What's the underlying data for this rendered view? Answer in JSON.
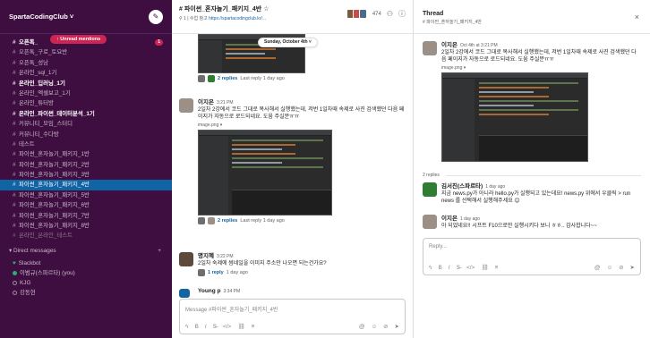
{
  "sidebar": {
    "workspace": "SpartaCodingClub ˅",
    "unread_pill": "↑ Unread mentions",
    "channels": [
      {
        "label": "오픈톡_",
        "style": "bold",
        "mention": "1"
      },
      {
        "label": "오픈톡_구로_토요반",
        "style": "normal"
      },
      {
        "label": "오픈톡_성남",
        "style": "normal"
      },
      {
        "label": "온라인_sql_1기",
        "style": "normal"
      },
      {
        "label": "온라인_딥러닝_1기",
        "style": "bold"
      },
      {
        "label": "온라인_엑셀보고_1기",
        "style": "normal"
      },
      {
        "label": "온라인_튜터방",
        "style": "normal"
      },
      {
        "label": "온라인_파이썬_데이터분석_1기",
        "style": "bold"
      },
      {
        "label": "커뮤니티_모임_스터디",
        "style": "normal"
      },
      {
        "label": "커뮤니티_수다방",
        "style": "normal"
      },
      {
        "label": "테스트",
        "style": "normal"
      },
      {
        "label": "파이썬_혼자놀기_패키지_1반",
        "style": "normal"
      },
      {
        "label": "파이썬_혼자놀기_패키지_2반",
        "style": "normal"
      },
      {
        "label": "파이썬_혼자놀기_패키지_3반",
        "style": "normal"
      },
      {
        "label": "파이썬_혼자놀기_패키지_4반",
        "style": "active"
      },
      {
        "label": "파이썬_혼자놀기_패키지_5반",
        "style": "normal"
      },
      {
        "label": "파이썬_혼자놀기_패키지_6반",
        "style": "normal"
      },
      {
        "label": "파이썬_혼자놀기_패키지_7반",
        "style": "normal"
      },
      {
        "label": "파이썬_혼자놀기_패키지_8반",
        "style": "normal"
      },
      {
        "label": "온라인_온라인_테스트",
        "style": "dim"
      }
    ],
    "dm_header": "▾ Direct messages",
    "dm_add": "+",
    "dms": [
      {
        "label": "Slackbot",
        "presence": "heart"
      },
      {
        "label": "이범규(스파르타) (you)",
        "presence": "on"
      },
      {
        "label": "KJG",
        "presence": "off"
      },
      {
        "label": "강동현",
        "presence": "off"
      }
    ]
  },
  "main": {
    "title": "# 파이썬_혼자놀기_패키지_4반 ☆",
    "subtitle_prefix": "⚲ 1 | 수업 참고 ",
    "subtitle_link": "https://spartacodingclub.kr/...",
    "member_count": "474",
    "date_pill": "Sunday, October 4th ˅",
    "messages": [
      {
        "replies": "2 replies",
        "last_reply": "Last reply 1 day ago"
      },
      {
        "name": "이지은",
        "time": "3:21 PM",
        "text": "2일차 2강에서 코드 그대로 복사해서 실행했는데, 저번 1일차때 속제로 사진 검색했던 다음 페이지가 자동으로 로드되네요. 도움 주실분ㅠㅠ",
        "image_label": "image.png ▾",
        "replies": "2 replies",
        "last_reply": "Last reply 1 day ago"
      },
      {
        "name": "명지혜",
        "time": "3:22 PM",
        "text": "2일차 숙제에 썸네일을 이미지 주소만 나오면 되는건가요?",
        "replies": "1 reply",
        "last_reply": "1 day ago"
      },
      {
        "name": "Young p",
        "time": "3:34 PM"
      }
    ],
    "composer_placeholder": "Message #파이썬_혼자놀기_패키지_4반"
  },
  "thread": {
    "title": "Thread",
    "subtitle": "# 파이썬_혼자놀기_패키지_4반",
    "close": "×",
    "parent": {
      "name": "이지은",
      "time": "Oct 4th at 3:21 PM",
      "text": "2일차 2강에서 코드 그대로 복사해서 실행했는데, 저번 1일차때 속제로 사진 검색했던 다음 페이지가 자동으로 로드되네요. 도움 주실분ㅠㅠ",
      "image_label": "image.png ▾"
    },
    "reply_count": "2 replies",
    "replies": [
      {
        "name": "김서진(스파르타)",
        "time": "1 day ago",
        "text_a": "지금 news.py가 아니라 hello.py가 실행되고 있는데요! news.py 위에서 우클릭 > run news 를 선택해서 실행해주세요 ",
        "emoji": "😊"
      },
      {
        "name": "이지은",
        "time": "1 day ago",
        "text": "아 되었네요!! 시프트 F10으로만 실행시키다 보니 ㅎㅎ.. 감사합니다~~"
      }
    ],
    "composer_placeholder": "Reply..."
  },
  "colors": {
    "sidebar_bg": "#3f0e40",
    "active_channel": "#1164a3",
    "mention_badge": "#cd2553",
    "link": "#1264a3",
    "presence": "#2bac76"
  }
}
